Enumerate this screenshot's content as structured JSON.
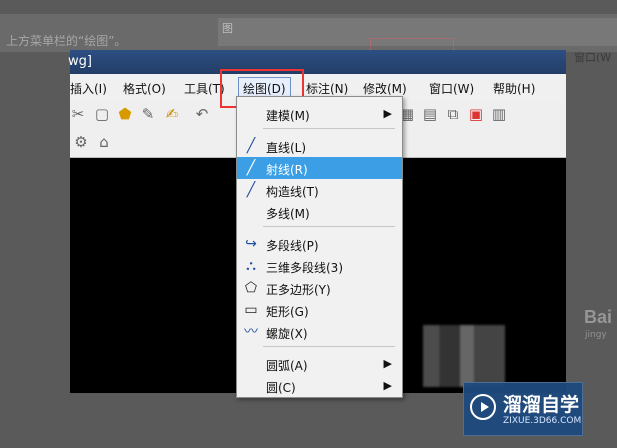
{
  "backdrop": {
    "caption": "上方菜单栏的“绘图”。",
    "top_label": "图",
    "window_label": "窗口(W"
  },
  "app": {
    "title": "wg]"
  },
  "menubar": {
    "items": [
      {
        "label": "插入(I)"
      },
      {
        "label": "格式(O)"
      },
      {
        "label": "工具(T)"
      },
      {
        "label": "绘图(D)"
      },
      {
        "label": "标注(N)"
      },
      {
        "label": "修改(M)"
      },
      {
        "label": "窗口(W)"
      },
      {
        "label": "帮助(H)"
      }
    ]
  },
  "toolbar": {
    "icons": [
      "cut-icon",
      "copy-icon",
      "paste-icon",
      "brush-icon",
      "match-icon",
      "undo-icon",
      "grid-icon",
      "layer-icon",
      "properties-icon",
      "calculator-icon",
      "help-icon"
    ]
  },
  "draw_menu": {
    "items": [
      {
        "label": "建模(M)",
        "icon": "",
        "arrow": "▶"
      },
      {
        "label": "直线(L)",
        "icon": "line-icon",
        "arrow": ""
      },
      {
        "label": "射线(R)",
        "icon": "ray-icon",
        "arrow": ""
      },
      {
        "label": "构造线(T)",
        "icon": "construction-line-icon",
        "arrow": ""
      },
      {
        "label": "多线(M)",
        "icon": "",
        "arrow": ""
      },
      {
        "label": "多段线(P)",
        "icon": "polyline-icon",
        "arrow": ""
      },
      {
        "label": "三维多段线(3)",
        "icon": "3d-polyline-icon",
        "arrow": ""
      },
      {
        "label": "正多边形(Y)",
        "icon": "polygon-icon",
        "arrow": ""
      },
      {
        "label": "矩形(G)",
        "icon": "rectangle-icon",
        "arrow": ""
      },
      {
        "label": "螺旋(X)",
        "icon": "helix-icon",
        "arrow": ""
      },
      {
        "label": "圆弧(A)",
        "icon": "",
        "arrow": "▶"
      },
      {
        "label": "圆(C)",
        "icon": "",
        "arrow": "▶"
      }
    ]
  },
  "watermark": {
    "brand": "溜溜自学",
    "site": "ZIXUE.3D66.COM",
    "baidu": "Bai",
    "baidu_sub": "jingy"
  }
}
